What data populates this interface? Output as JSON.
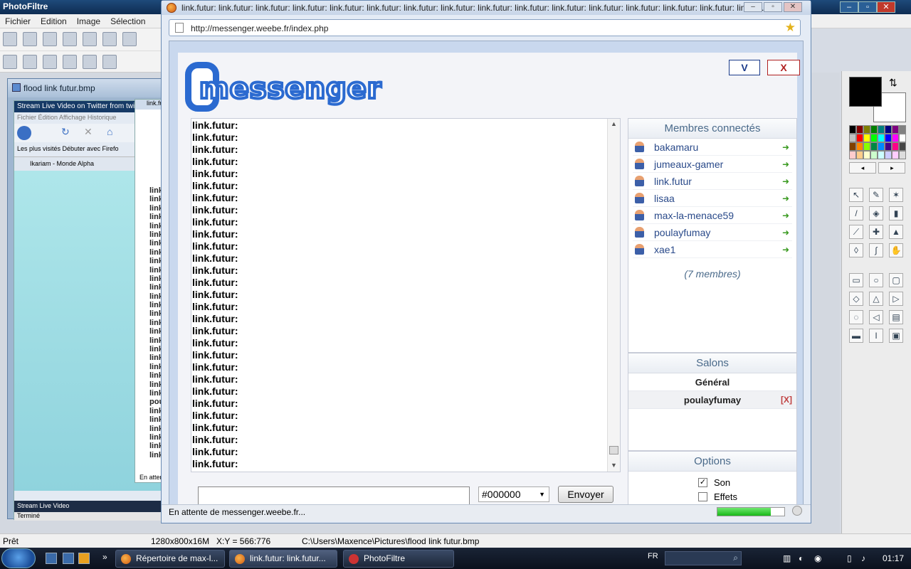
{
  "photofiltre": {
    "title": "PhotoFiltre",
    "menu": [
      "Fichier",
      "Edition",
      "Image",
      "Sélection"
    ],
    "bitmap_window_title": "flood link futur.bmp",
    "status": {
      "ready": "Prêt",
      "dimensions": "1280x800x16M",
      "coords": "X:Y = 566:776",
      "path": "C:\\Users\\Maxence\\Pictures\\flood link futur.bmp"
    },
    "colors": {
      "foreground": "#000000",
      "background": "#ffffff"
    }
  },
  "background_browser": {
    "title": "Stream Live Video on Twitter from twi",
    "menu": "Fichier  Édition  Affichage  Historique",
    "bookmarks": "Les plus visités   Débuter avec Firefo",
    "tab": "Ikariam - Monde Alpha",
    "status": "Terminé",
    "task": "Stream Live Video",
    "second_title": "link.fu",
    "second_status": "En atten",
    "second_lines": [
      "link",
      "link",
      "link",
      "link",
      "link",
      "link",
      "link",
      "link",
      "link",
      "link",
      "link",
      "link",
      "link",
      "link",
      "link",
      "link",
      "link",
      "link",
      "link",
      "link",
      "link",
      "link",
      "link",
      "link",
      "pou",
      "link",
      "link",
      "link",
      "link",
      "link",
      "link"
    ]
  },
  "browser": {
    "title": "link.futur: link.futur: link.futur: link.futur: link.futur: link.futur: link.futur: link.futur: link.futur: link.futur: link.futur: link.futur: link.futur: link.futur: link.futur: link.fut...",
    "url": "http://messenger.weebe.fr/index.php",
    "status": "En attente de messenger.weebe.fr...",
    "progress": 0.8
  },
  "messenger": {
    "logo_text": "messenger",
    "btn_v": "V",
    "btn_x": "X",
    "messages": [
      "link.futur:",
      "link.futur:",
      "link.futur:",
      "link.futur:",
      "link.futur:",
      "link.futur:",
      "link.futur:",
      "link.futur:",
      "link.futur:",
      "link.futur:",
      "link.futur:",
      "link.futur:",
      "link.futur:",
      "link.futur:",
      "link.futur:",
      "link.futur:",
      "link.futur:",
      "link.futur:",
      "link.futur:",
      "link.futur:",
      "link.futur:",
      "link.futur:",
      "link.futur:",
      "link.futur:",
      "link.futur:",
      "link.futur:",
      "link.futur:",
      "link.futur:",
      "link.futur:"
    ],
    "color_value": "#000000",
    "send_label": "Envoyer",
    "members_header": "Membres connectés",
    "members": [
      "bakamaru",
      "jumeaux-gamer",
      "link.futur",
      "lisaa",
      "max-la-menace59",
      "poulayfumay",
      "xae1"
    ],
    "members_count": "(7 membres)",
    "salons_header": "Salons",
    "salons": [
      {
        "name": "Général",
        "close": ""
      },
      {
        "name": "poulayfumay",
        "close": "[X]"
      }
    ],
    "options_header": "Options",
    "options": [
      {
        "label": "Son",
        "checked": "✓"
      },
      {
        "label": "Effets",
        "checked": ""
      }
    ]
  },
  "taskbar": {
    "tasks": [
      "Répertoire de max-l...",
      "link.futur: link.futur...",
      "PhotoFiltre"
    ],
    "language": "FR",
    "clock": "01:17"
  }
}
